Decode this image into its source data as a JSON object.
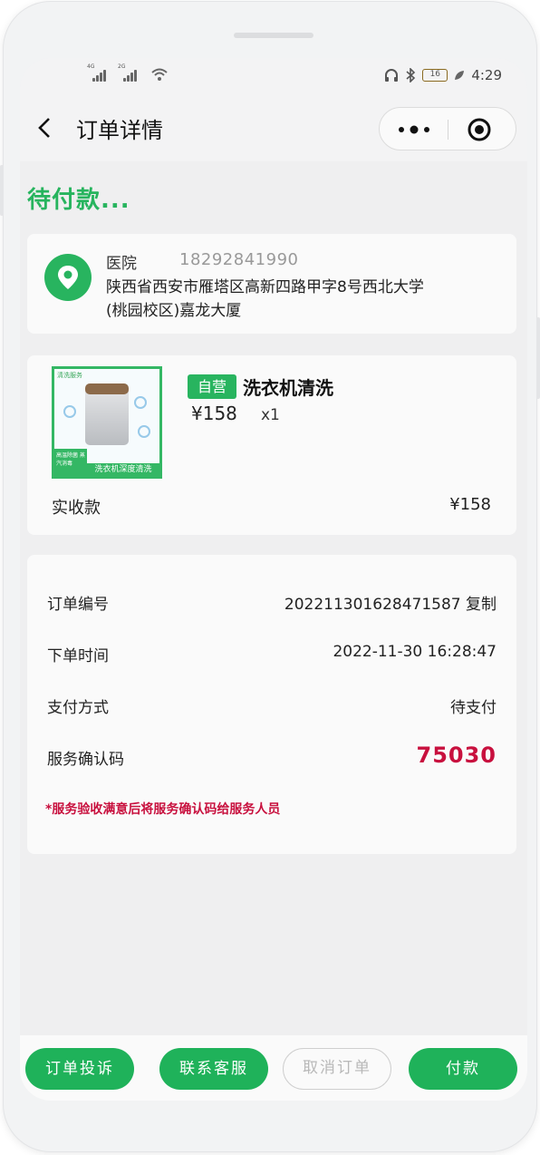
{
  "status_bar": {
    "signal_1_label": "4G",
    "signal_2_label": "2G",
    "battery": "16",
    "time": "4:29"
  },
  "nav": {
    "title": "订单详情"
  },
  "order_status": "待付款...",
  "address": {
    "name": "医院",
    "phone": "18292841990",
    "detail": "陕西省西安市雁塔区高新四路甲字8号西北大学(桃园校区)嘉龙大厦"
  },
  "product": {
    "image_top_text": "清洗服务",
    "image_badge_text": "高温除菌 蒸汽消毒",
    "image_banner_text": "洗衣机深度清洗",
    "tag": "自营",
    "name": "洗衣机清洗",
    "price": "¥158",
    "qty": "x1",
    "total_label": "实收款",
    "total_value": "¥158"
  },
  "order_info": {
    "order_no_label": "订单编号",
    "order_no_value": "20221130162847​1587 复制",
    "time_label": "下单时间",
    "time_value": "2022-11-30 16:28:47",
    "pay_label": "支付方式",
    "pay_value": "待支付",
    "code_label": "服务确认码",
    "code_value": "75030",
    "notice": "*服务验收满意后将服务确认码给服务人员"
  },
  "actions": {
    "complaint": "订单投诉",
    "service": "联系客服",
    "cancel": "取消订单",
    "pay": "付款"
  },
  "colors": {
    "brand_green": "#1fb25a",
    "alert_red": "#c8103e"
  }
}
